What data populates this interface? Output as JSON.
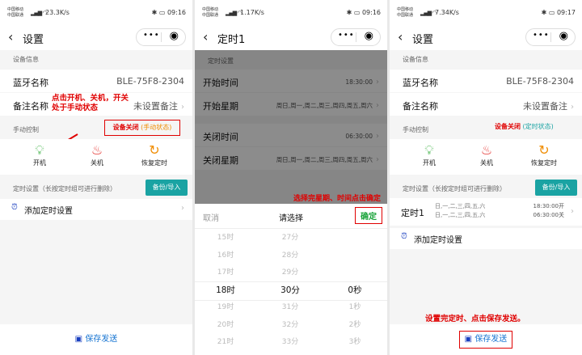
{
  "status": {
    "p1": {
      "carrier1": "中国移动",
      "carrier2": "中国联通",
      "speed": "23.3K/s",
      "time": "09:16",
      "battery": "76"
    },
    "p2": {
      "carrier1": "中国移动",
      "carrier2": "中国联通",
      "speed": "1.17K/s",
      "time": "09:16",
      "battery": "76"
    },
    "p3": {
      "carrier1": "中国移动",
      "carrier2": "中国联通",
      "speed": "7.34K/s",
      "time": "09:17",
      "battery": "76"
    }
  },
  "screen1": {
    "title": "设置",
    "device_info_label": "设备信息",
    "bt_name_label": "蓝牙名称",
    "bt_name_value": "BLE-75F8-2304",
    "alias_label": "备注名称",
    "alias_value": "未设置备注",
    "manual_label": "手动控制",
    "device_status": "设备关闭",
    "device_mode": "(手动状态)",
    "on_label": "开机",
    "off_label": "关机",
    "restore_label": "恢复定时",
    "timer_label": "定时设置（长按定时组可进行删除）",
    "backup_label": "备份/导入",
    "add_timer_label": "添加定时设置",
    "save_label": "保存发送",
    "annotation": "点击开机、关机，开关处于手动状态"
  },
  "screen2": {
    "title": "定时1",
    "section": "定时设置",
    "start_time_label": "开始时间",
    "start_time_value": "18:30:00",
    "start_week_label": "开始星期",
    "start_week_value": "周日,周一,周二,周三,周四,周五,周六",
    "close_time_label": "关闭时间",
    "close_time_value": "06:30:00",
    "close_week_label": "关闭星期",
    "close_week_value": "周日,周一,周二,周三,周四,周五,周六",
    "annotation": "选择完星期、时间点击确定",
    "cancel": "取消",
    "picker_title": "请选择",
    "confirm": "确定",
    "hours": [
      "15时",
      "16时",
      "17时",
      "18时",
      "19时",
      "20时",
      "21时"
    ],
    "minutes": [
      "27分",
      "28分",
      "29分",
      "30分",
      "31分",
      "32分",
      "33分"
    ],
    "seconds": [
      "",
      "",
      "",
      "0秒",
      "1秒",
      "2秒",
      "3秒"
    ]
  },
  "screen3": {
    "title": "设置",
    "device_info_label": "设备信息",
    "bt_name_label": "蓝牙名称",
    "bt_name_value": "BLE-75F8-2304",
    "alias_label": "备注名称",
    "alias_value": "未设置备注",
    "manual_label": "手动控制",
    "device_status": "设备关闭",
    "device_mode": "(定时状态)",
    "on_label": "开机",
    "off_label": "关机",
    "restore_label": "恢复定时",
    "timer_label": "定时设置（长按定时组可进行删除）",
    "backup_label": "备份/导入",
    "timer1_label": "定时1",
    "timer1_week_on": "日,一,二,三,四,五,六",
    "timer1_time_on": "18:30:00开",
    "timer1_week_off": "日,一,二,三,四,五,六",
    "timer1_time_off": "06:30:00关",
    "add_timer_label": "添加定时设置",
    "save_label": "保存发送",
    "annotation": "设置完定时、点击保存发送。"
  },
  "colors": {
    "accent_teal": "#1aa3a3",
    "annotation_red": "#e00000",
    "save_blue": "#1976d2",
    "on_green": "#3cb043",
    "off_red": "#e53935",
    "restore_orange": "#f08c00"
  },
  "icons": {
    "bulb_on": "lightbulb-icon",
    "bell_off": "bell-off-icon",
    "restore": "refresh-icon",
    "alarm": "alarm-clock-icon",
    "save": "floppy-disk-icon"
  }
}
